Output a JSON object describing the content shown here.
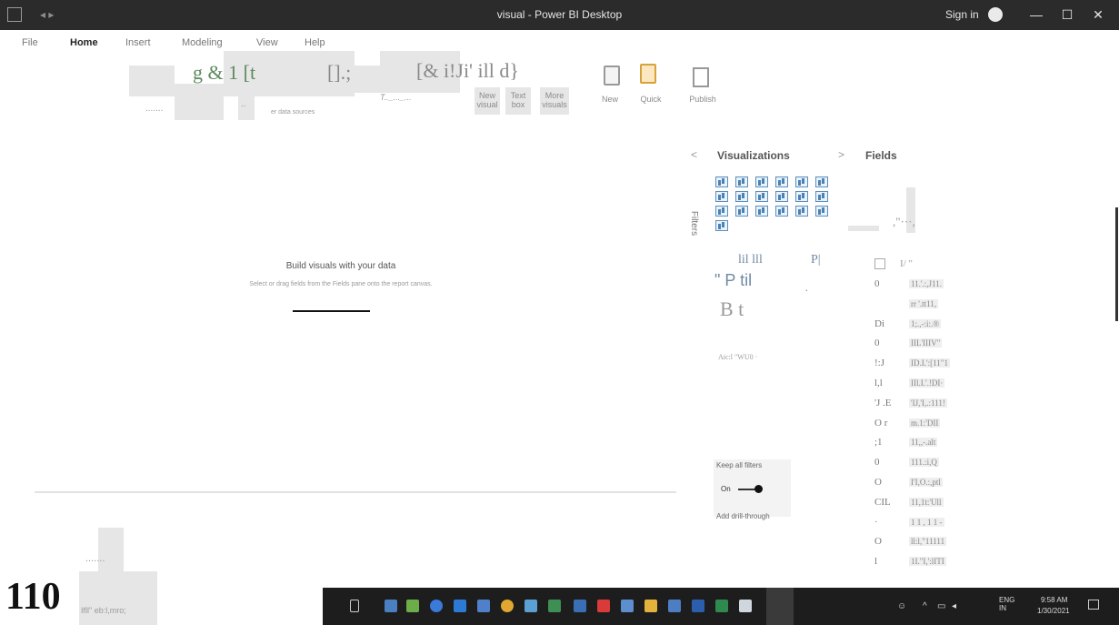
{
  "titlebar": {
    "quick_access": "◂ ▸",
    "title": "visual - Power BI Desktop",
    "signin": "Sign in",
    "minimize": "—",
    "maximize": "☐",
    "close": "✕"
  },
  "tabs": [
    "File",
    "Home",
    "Insert",
    "Modeling",
    "View",
    "Help"
  ],
  "ribbon": {
    "garble_1": "g & 1 [t",
    "garble_2": "[].;",
    "garble_3": "[& i!Ji' ill d}",
    "dots_1": ".......",
    "dots_2": "..",
    "sources_label": "er data sources",
    "t_label": "T.._..._...",
    "new_visual": "New visual",
    "text_box": "Text box",
    "more_visuals": "More visuals",
    "new_measure": "New",
    "quick_measure": "Quick",
    "publish": "Publish"
  },
  "canvas": {
    "title": "Build visuals with your data",
    "subtitle": "Select or drag fields from the Fields pane onto the report canvas."
  },
  "visualizations": {
    "collapse": "<",
    "title": "Visualizations",
    "chevron": ">",
    "filters_label": "Filters",
    "garble_row1": "lil lll",
    "garble_p": "P|",
    "garble_row2": "\" P til",
    "garble_bt": "B t",
    "dot": "·",
    "values_label": "Aic:l \"WU0 ·",
    "keep_filters": "Keep all filters",
    "toggle_on": "On",
    "drill_label": "Add drill-through"
  },
  "fields": {
    "title": "Fields",
    "top_garble": ",\"···,",
    "search_garble": "I/ \"",
    "rows": [
      {
        "left": "0",
        "right": "11.'.:,J11."
      },
      {
        "left": "",
        "right": "rr '.tt11,"
      },
      {
        "left": "Di",
        "right": "1;.,-:i:.®"
      },
      {
        "left": "0",
        "right": "IIL'IIIV\""
      },
      {
        "left": "!:J",
        "right": "ID.I.':[11\"1"
      },
      {
        "left": "l,l",
        "right": "IIl.I.'.!DI·"
      },
      {
        "left": "'J .E",
        "right": "'IJ,'I,.:111!"
      },
      {
        "left": "O r",
        "right": "m.1:'DII"
      },
      {
        "left": ";1",
        "right": "11,,-.alt"
      },
      {
        "left": "0",
        "right": "111.:i,Q"
      },
      {
        "left": "O",
        "right": "I'I,O.:,ptl"
      },
      {
        "left": "CIL",
        "right": "11,1t:'Ull"
      },
      {
        "left": "·",
        "right": "1 1 , 1 1 -"
      },
      {
        "left": "O",
        "right": "ll:l,\"11111"
      },
      {
        "left": "l",
        "right": "1I.\"I,':lITI"
      }
    ]
  },
  "bottom": {
    "page_number": "110",
    "page_label": "Ifll\" eb:l,mro;",
    "dots": "......."
  },
  "taskbar": {
    "tray_lang": "ENG IN",
    "time": "9:58 AM",
    "date": "1/30/2021"
  }
}
